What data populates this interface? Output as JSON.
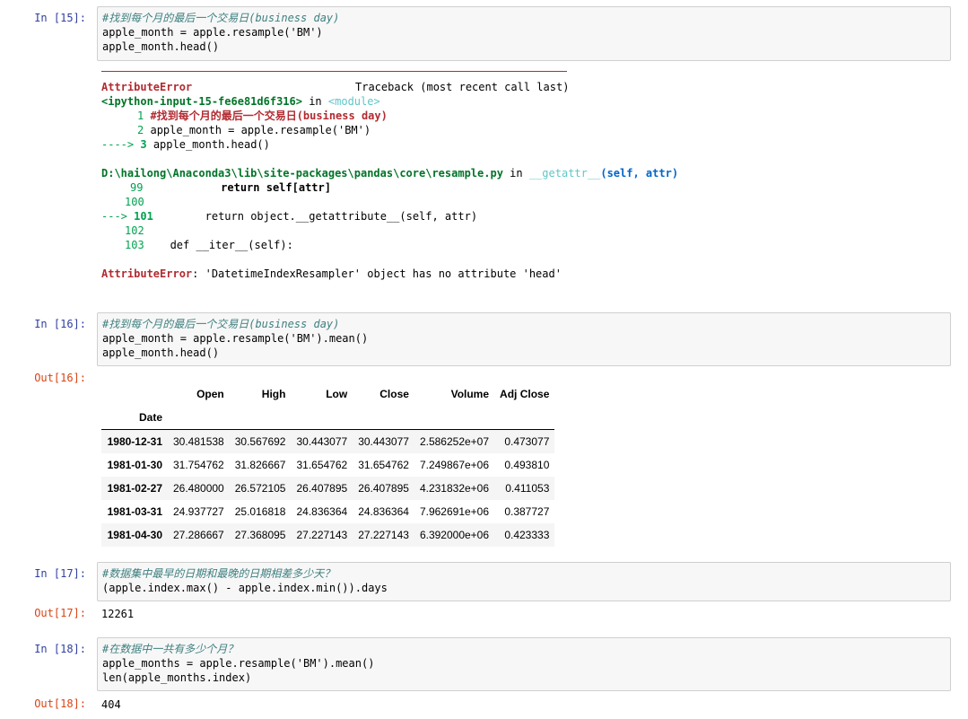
{
  "cells": [
    {
      "in_prompt": "In  [15]:",
      "code": [
        "#找到每个月的最后一个交易日(business day)",
        "apple_month = apple.resample('BM')",
        "apple_month.head()"
      ]
    },
    {
      "in_prompt": "In  [16]:",
      "code": [
        "#找到每个月的最后一个交易日(business day)",
        "apple_month = apple.resample('BM').mean()",
        "apple_month.head()"
      ],
      "out_prompt": "Out[16]:"
    },
    {
      "in_prompt": "In  [17]:",
      "code": [
        "#数据集中最早的日期和最晚的日期相差多少天？",
        "(apple.index.max() - apple.index.min()).days"
      ],
      "out_prompt": "Out[17]:",
      "output": "12261"
    },
    {
      "in_prompt": "In  [18]:",
      "code": [
        "#在数据中一共有多少个月？",
        "apple_months = apple.resample('BM').mean()",
        "len(apple_months.index)"
      ],
      "out_prompt": "Out[18]:",
      "output": "404"
    }
  ],
  "traceback": {
    "error_name": "AttributeError",
    "header_right": "Traceback (most recent call last)",
    "input_ref": "<ipython-input-15-fe6e81d6f316>",
    "in_word": "in",
    "module": "<module>",
    "frame1_lines": [
      {
        "num": "1",
        "code": "#找到每个月的最后一个交易日(business day)"
      },
      {
        "num": "2",
        "code": "apple_month = apple.resample('BM')"
      },
      {
        "arrow": "---->",
        "num": "3",
        "code": "apple_month.head()"
      }
    ],
    "file_path": "D:\\hailong\\Anaconda3\\lib\\site-packages\\pandas\\core\\resample.py",
    "func": "__getattr__",
    "args": "(self, attr)",
    "frame2_lines": [
      {
        "num": "99",
        "code": "            return self[attr]"
      },
      {
        "num": "100",
        "code": ""
      },
      {
        "arrow": "--->",
        "num": "101",
        "code": "        return object.__getattribute__(self, attr)"
      },
      {
        "num": "102",
        "code": ""
      },
      {
        "num": "103",
        "code": "    def __iter__(self):"
      }
    ],
    "final_error": "AttributeError",
    "final_message": ": 'DatetimeIndexResampler' object has no attribute 'head'"
  },
  "dataframe": {
    "columns": [
      "Open",
      "High",
      "Low",
      "Close",
      "Volume",
      "Adj Close"
    ],
    "index_name": "Date",
    "rows": [
      {
        "date": "1980-12-31",
        "values": [
          "30.481538",
          "30.567692",
          "30.443077",
          "30.443077",
          "2.586252e+07",
          "0.473077"
        ]
      },
      {
        "date": "1981-01-30",
        "values": [
          "31.754762",
          "31.826667",
          "31.654762",
          "31.654762",
          "7.249867e+06",
          "0.493810"
        ]
      },
      {
        "date": "1981-02-27",
        "values": [
          "26.480000",
          "26.572105",
          "26.407895",
          "26.407895",
          "4.231832e+06",
          "0.411053"
        ]
      },
      {
        "date": "1981-03-31",
        "values": [
          "24.937727",
          "25.016818",
          "24.836364",
          "24.836364",
          "7.962691e+06",
          "0.387727"
        ]
      },
      {
        "date": "1981-04-30",
        "values": [
          "27.286667",
          "27.368095",
          "27.227143",
          "27.227143",
          "6.392000e+06",
          "0.423333"
        ]
      }
    ]
  }
}
